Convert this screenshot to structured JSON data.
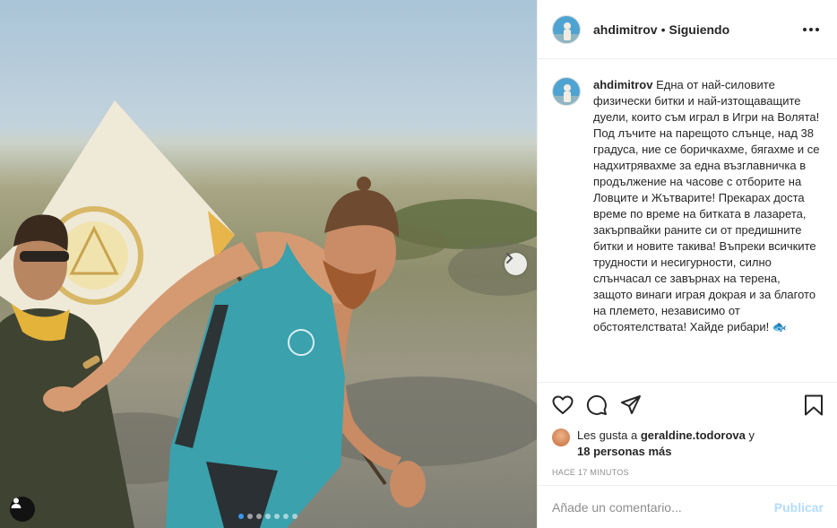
{
  "post": {
    "username": "ahdimitrov",
    "separator": "•",
    "follow_status": "Siguiendo",
    "more_icon": "more-horizontal-icon"
  },
  "caption": {
    "username": "ahdimitrov",
    "text": "Една от най-силовите физически битки и най-изтощаващите дуели, които съм играл в Игри на Волята! Под лъчите на парещото слънце, над 38 градуса, ние се боричкахме, бягахме и се надхитрявахме за една възглавничка в продължение на часове с отборите на Ловците и Жътварите! Прекарах доста време по време на битката в лазарета, закърпвайки раните си от предишните битки и новите такива! Въпреки всичките трудности и несигурности, силно слънчасал се завърнах на терена, защото винаги играя докрая и за благото на племето, независимо от обстоятелствата! Хайде рибари! 🐟"
  },
  "actions": {
    "like_icon": "heart-icon",
    "comment_icon": "comment-icon",
    "share_icon": "share-paper-plane-icon",
    "save_icon": "bookmark-icon"
  },
  "likes": {
    "prefix": "Les gusta a ",
    "liker": "geraldine.todorova",
    "conjunction": " y ",
    "others": "18 personas más"
  },
  "timestamp": "Hace 17 minutos",
  "comment": {
    "placeholder": "Añade un comentario...",
    "publish_label": "Publicar"
  },
  "carousel": {
    "slide_count": 7,
    "active_index": 0,
    "next_icon": "chevron-right-icon",
    "tag_icon": "user-tag-icon"
  },
  "colors": {
    "link_disabled": "#b3dbff",
    "active_dot": "#3897f0",
    "muted_text": "#8e8e8e"
  }
}
